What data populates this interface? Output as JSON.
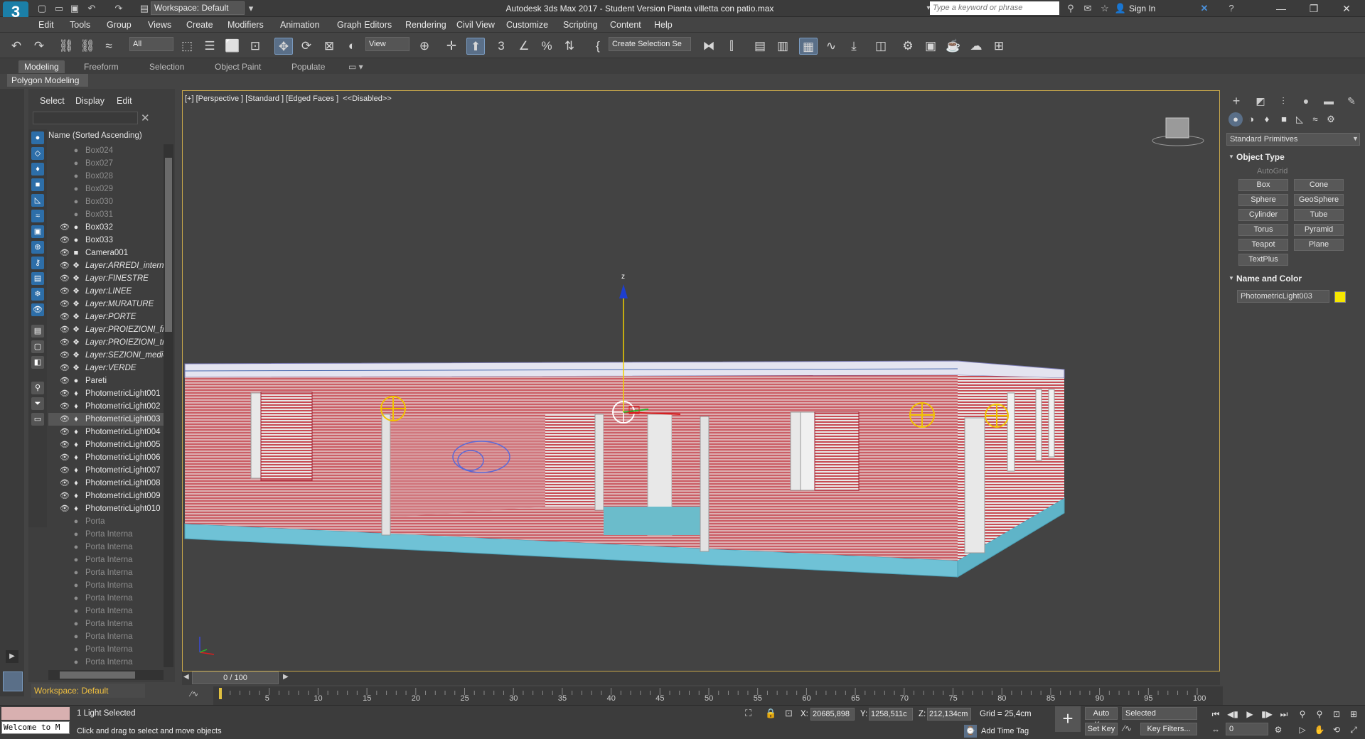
{
  "app": {
    "title": "Autodesk 3ds Max 2017 - Student Version    Pianta villetta con patio.max",
    "workspace": "Workspace: Default",
    "logo": "3"
  },
  "search": {
    "placeholder": "Type a keyword or phrase"
  },
  "signin": "Sign In",
  "menu": [
    "Edit",
    "Tools",
    "Group",
    "Views",
    "Create",
    "Modifiers",
    "Animation",
    "Graph Editors",
    "Rendering",
    "Civil View",
    "Customize",
    "Scripting",
    "Content",
    "Help"
  ],
  "toolbar": {
    "filter": "All",
    "ref_coord": "View",
    "selection_set": "Create Selection Se"
  },
  "ribbon": {
    "tabs": [
      "Modeling",
      "Freeform",
      "Selection",
      "Object Paint",
      "Populate"
    ],
    "sub": "Polygon Modeling"
  },
  "scene_explorer": {
    "tabs": [
      "Select",
      "Display",
      "Edit"
    ],
    "header": "Name (Sorted Ascending)",
    "workspace": "Workspace: Default",
    "rows": [
      {
        "name": "Box024",
        "icon": "●",
        "eye": "",
        "state": "dim"
      },
      {
        "name": "Box027",
        "icon": "●",
        "eye": "",
        "state": "dim"
      },
      {
        "name": "Box028",
        "icon": "●",
        "eye": "",
        "state": "dim"
      },
      {
        "name": "Box029",
        "icon": "●",
        "eye": "",
        "state": "dim"
      },
      {
        "name": "Box030",
        "icon": "●",
        "eye": "",
        "state": "dim"
      },
      {
        "name": "Box031",
        "icon": "●",
        "eye": "",
        "state": "dim"
      },
      {
        "name": "Box032",
        "icon": "●",
        "eye": "👁",
        "state": ""
      },
      {
        "name": "Box033",
        "icon": "●",
        "eye": "👁",
        "state": ""
      },
      {
        "name": "Camera001",
        "icon": "■",
        "eye": "👁",
        "state": ""
      },
      {
        "name": "Layer:ARREDI_interni",
        "icon": "❖",
        "eye": "👁",
        "state": "italic"
      },
      {
        "name": "Layer:FINESTRE",
        "icon": "❖",
        "eye": "👁",
        "state": "italic"
      },
      {
        "name": "Layer:LINEE",
        "icon": "❖",
        "eye": "👁",
        "state": "italic"
      },
      {
        "name": "Layer:MURATURE",
        "icon": "❖",
        "eye": "👁",
        "state": "italic"
      },
      {
        "name": "Layer:PORTE",
        "icon": "❖",
        "eye": "👁",
        "state": "italic"
      },
      {
        "name": "Layer:PROIEZIONI_fin",
        "icon": "❖",
        "eye": "👁",
        "state": "italic"
      },
      {
        "name": "Layer:PROIEZIONI_tra",
        "icon": "❖",
        "eye": "👁",
        "state": "italic"
      },
      {
        "name": "Layer:SEZIONI_medie",
        "icon": "❖",
        "eye": "👁",
        "state": "italic"
      },
      {
        "name": "Layer:VERDE",
        "icon": "❖",
        "eye": "👁",
        "state": "italic"
      },
      {
        "name": "Pareti",
        "icon": "●",
        "eye": "👁",
        "state": ""
      },
      {
        "name": "PhotometricLight001",
        "icon": "♦",
        "eye": "👁",
        "state": ""
      },
      {
        "name": "PhotometricLight002",
        "icon": "♦",
        "eye": "👁",
        "state": ""
      },
      {
        "name": "PhotometricLight003",
        "icon": "♦",
        "eye": "👁",
        "state": "sel"
      },
      {
        "name": "PhotometricLight004",
        "icon": "♦",
        "eye": "👁",
        "state": ""
      },
      {
        "name": "PhotometricLight005",
        "icon": "♦",
        "eye": "👁",
        "state": ""
      },
      {
        "name": "PhotometricLight006",
        "icon": "♦",
        "eye": "👁",
        "state": ""
      },
      {
        "name": "PhotometricLight007",
        "icon": "♦",
        "eye": "👁",
        "state": ""
      },
      {
        "name": "PhotometricLight008",
        "icon": "♦",
        "eye": "👁",
        "state": ""
      },
      {
        "name": "PhotometricLight009",
        "icon": "♦",
        "eye": "👁",
        "state": ""
      },
      {
        "name": "PhotometricLight010",
        "icon": "♦",
        "eye": "👁",
        "state": ""
      },
      {
        "name": "Porta",
        "icon": "●",
        "eye": "",
        "state": "dim"
      },
      {
        "name": "Porta Interna",
        "icon": "●",
        "eye": "",
        "state": "dim"
      },
      {
        "name": "Porta Interna",
        "icon": "●",
        "eye": "",
        "state": "dim"
      },
      {
        "name": "Porta Interna",
        "icon": "●",
        "eye": "",
        "state": "dim"
      },
      {
        "name": "Porta Interna",
        "icon": "●",
        "eye": "",
        "state": "dim"
      },
      {
        "name": "Porta Interna",
        "icon": "●",
        "eye": "",
        "state": "dim"
      },
      {
        "name": "Porta Interna",
        "icon": "●",
        "eye": "",
        "state": "dim"
      },
      {
        "name": "Porta Interna",
        "icon": "●",
        "eye": "",
        "state": "dim"
      },
      {
        "name": "Porta Interna",
        "icon": "●",
        "eye": "",
        "state": "dim"
      },
      {
        "name": "Porta Interna",
        "icon": "●",
        "eye": "",
        "state": "dim"
      },
      {
        "name": "Porta Interna",
        "icon": "●",
        "eye": "",
        "state": "dim"
      },
      {
        "name": "Porta Interna",
        "icon": "●",
        "eye": "",
        "state": "dim"
      }
    ]
  },
  "viewport": {
    "label": "[+] [Perspective ] [Standard ] [Edged Faces ]  <<Disabled>>",
    "axis_z": "z"
  },
  "command_panel": {
    "primitive_type": "Standard Primitives",
    "object_type_title": "Object Type",
    "autogrid": "AutoGrid",
    "primitives": [
      "Box",
      "Cone",
      "Sphere",
      "GeoSphere",
      "Cylinder",
      "Tube",
      "Torus",
      "Pyramid",
      "Teapot",
      "Plane",
      "TextPlus"
    ],
    "name_color_title": "Name and Color",
    "object_name": "PhotometricLight003",
    "object_color": "#f5e600"
  },
  "timeline": {
    "frame": "0 / 100",
    "ticks": [
      "5",
      "10",
      "15",
      "20",
      "25",
      "30",
      "35",
      "40",
      "45",
      "50",
      "55",
      "60",
      "65",
      "70",
      "75",
      "80",
      "85",
      "90",
      "95",
      "100"
    ]
  },
  "status": {
    "listener": "Welcome to M",
    "selection": "1 Light Selected",
    "prompt": "Click and drag to select and move objects",
    "x_label": "X:",
    "x": "20685,898",
    "y_label": "Y:",
    "y": "1258,511c",
    "z_label": "Z:",
    "z": "212,134cm",
    "grid": "Grid = 25,4cm",
    "add_time_tag": "Add Time Tag",
    "auto_key": "Auto Key",
    "set_key": "Set Key",
    "selected": "Selected",
    "key_filters": "Key Filters...",
    "frame_value": "0"
  }
}
